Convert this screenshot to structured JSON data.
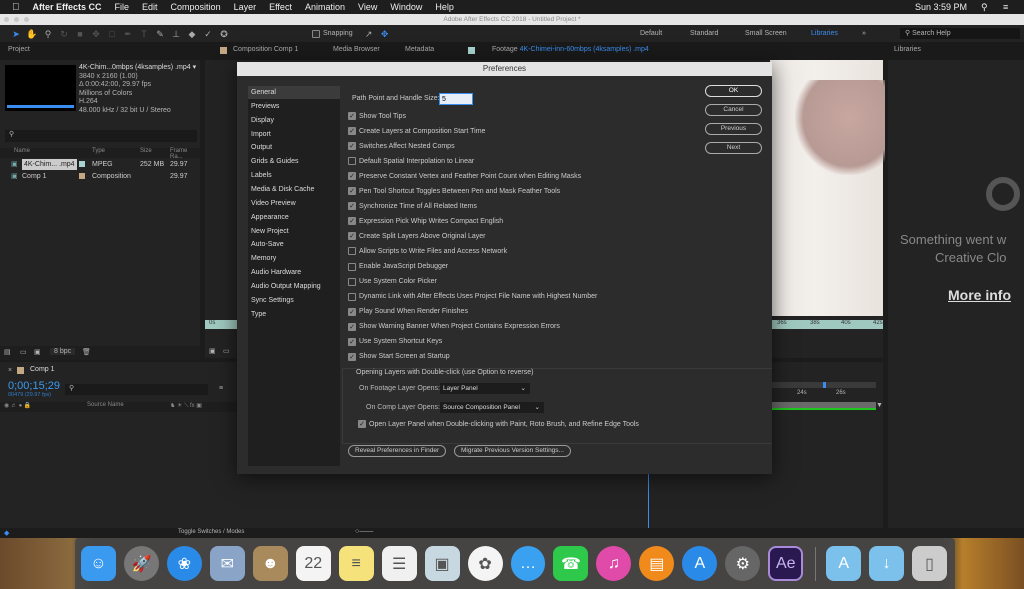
{
  "menubar": {
    "app": "After Effects CC",
    "items": [
      "File",
      "Edit",
      "Composition",
      "Layer",
      "Effect",
      "Animation",
      "View",
      "Window",
      "Help"
    ],
    "clock": "Sun 3:59 PM"
  },
  "window": {
    "title": "Adobe After Effects CC 2018 - Untitled Project *"
  },
  "toolbar": {
    "snapping": "Snapping",
    "workspaces": [
      "Default",
      "Standard",
      "Small Screen",
      "Libraries"
    ],
    "active_workspace": "Libraries",
    "search_placeholder": "Search Help"
  },
  "tabs": {
    "project": "Project",
    "composition": "Composition Comp 1",
    "media_browser": "Media Browser",
    "metadata": "Metadata",
    "footage_prefix": "Footage",
    "footage_name": "4K-Chimei-inn-60mbps (4ksamples) .mp4",
    "libraries": "Libraries"
  },
  "project": {
    "name": "4K-Chim...0mbps (4ksamples) .mp4 ▾",
    "info": [
      "3840 x 2160 (1.00)",
      "Δ 0:00:42:00, 29.97 fps",
      "Millions of Colors",
      "H.264",
      "48.000 kHz / 32 bit U / Stereo"
    ],
    "columns": [
      "Name",
      "Type",
      "Size",
      "Frame Ra..."
    ],
    "rows": [
      {
        "name": "4K-Chim... .mp4",
        "type": "MPEG",
        "size": "252 MB",
        "fps": "29.97",
        "color": "#a7d4cf"
      },
      {
        "name": "Comp 1",
        "type": "Composition",
        "size": "",
        "fps": "29.97",
        "color": "#c4a883"
      }
    ],
    "bpc": "8 bpc"
  },
  "viewer": {
    "ruler_ticks": [
      "0s",
      "36s",
      "38s",
      "40s",
      "42s"
    ]
  },
  "libraries": {
    "message1": "Something went w",
    "message2": "Creative Clo",
    "more_info": "More info"
  },
  "timeline": {
    "comp": "Comp 1",
    "timecode": "0;00;15;29",
    "frames": "00479 (29.97 fps)",
    "source_name": "Source Name",
    "ticks": [
      "24s",
      "26s"
    ],
    "toggle": "Toggle Switches / Modes"
  },
  "prefs": {
    "title": "Preferences",
    "categories": [
      "General",
      "Previews",
      "Display",
      "Import",
      "Output",
      "Grids & Guides",
      "Labels",
      "Media & Disk Cache",
      "Video Preview",
      "Appearance",
      "New Project",
      "Auto-Save",
      "Memory",
      "Audio Hardware",
      "Audio Output Mapping",
      "Sync Settings",
      "Type"
    ],
    "selected": "General",
    "path_label": "Path Point and Handle Size:",
    "path_value": "5",
    "options": [
      {
        "label": "Show Tool Tips",
        "checked": true
      },
      {
        "label": "Create Layers at Composition Start Time",
        "checked": true
      },
      {
        "label": "Switches Affect Nested Comps",
        "checked": true
      },
      {
        "label": "Default Spatial Interpolation to Linear",
        "checked": false
      },
      {
        "label": "Preserve Constant Vertex and Feather Point Count when Editing Masks",
        "checked": true
      },
      {
        "label": "Pen Tool Shortcut Toggles Between Pen and Mask Feather Tools",
        "checked": true
      },
      {
        "label": "Synchronize Time of All Related Items",
        "checked": true
      },
      {
        "label": "Expression Pick Whip Writes Compact English",
        "checked": true
      },
      {
        "label": "Create Split Layers Above Original Layer",
        "checked": true
      },
      {
        "label": "Allow Scripts to Write Files and Access Network",
        "checked": false
      },
      {
        "label": "Enable JavaScript Debugger",
        "checked": false
      },
      {
        "label": "Use System Color Picker",
        "checked": false
      },
      {
        "label": "Dynamic Link with After Effects Uses Project File Name with Highest Number",
        "checked": false
      },
      {
        "label": "Play Sound When Render Finishes",
        "checked": true
      },
      {
        "label": "Show Warning Banner When Project Contains Expression Errors",
        "checked": true
      },
      {
        "label": "Use System Shortcut Keys",
        "checked": true
      },
      {
        "label": "Show Start Screen at Startup",
        "checked": true
      }
    ],
    "group_title": "Opening Layers with Double-click (use Option to reverse)",
    "footage_label": "On Footage Layer Opens:",
    "footage_value": "Layer Panel",
    "comp_label": "On Comp Layer Opens:",
    "comp_value": "Source Composition Panel",
    "open_layer_label": "Open Layer Panel when Double-clicking with Paint, Roto Brush, and Refine Edge Tools",
    "open_layer_checked": true,
    "buttons": {
      "ok": "OK",
      "cancel": "Cancel",
      "previous": "Previous",
      "next": "Next",
      "reveal": "Reveal Preferences in Finder",
      "migrate": "Migrate Previous Version Settings..."
    }
  },
  "dock": [
    {
      "name": "finder",
      "glyph": "☺",
      "color": "#3a9af0"
    },
    {
      "name": "launchpad",
      "glyph": "🚀",
      "color": "#777"
    },
    {
      "name": "safari",
      "glyph": "❀",
      "color": "#2a8ae8"
    },
    {
      "name": "mail",
      "glyph": "✉",
      "color": "#8aa4c8"
    },
    {
      "name": "contacts",
      "glyph": "☻",
      "color": "#a88a5c"
    },
    {
      "name": "calendar",
      "glyph": "22",
      "color": "#f4f4f4"
    },
    {
      "name": "notes",
      "glyph": "≡",
      "color": "#f6e27a"
    },
    {
      "name": "reminders",
      "glyph": "☰",
      "color": "#f0f0f0"
    },
    {
      "name": "preview",
      "glyph": "▣",
      "color": "#c8d8e0"
    },
    {
      "name": "photos",
      "glyph": "✿",
      "color": "#f4f4f4"
    },
    {
      "name": "messages",
      "glyph": "…",
      "color": "#3aa0f0"
    },
    {
      "name": "facetime",
      "glyph": "☎",
      "color": "#2ec84a"
    },
    {
      "name": "itunes",
      "glyph": "♫",
      "color": "#e04aa8"
    },
    {
      "name": "ibooks",
      "glyph": "▤",
      "color": "#f08a1a"
    },
    {
      "name": "app-store",
      "glyph": "A",
      "color": "#2a8ae8"
    },
    {
      "name": "system-preferences",
      "glyph": "⚙",
      "color": "#666"
    },
    {
      "name": "after-effects",
      "glyph": "Ae",
      "color": "#2a1850"
    },
    {
      "name": "applications-folder",
      "glyph": "A",
      "color": "#7cc0ec"
    },
    {
      "name": "downloads-folder",
      "glyph": "↓",
      "color": "#7cc0ec"
    },
    {
      "name": "trash",
      "glyph": "▯",
      "color": "#ccc"
    }
  ]
}
